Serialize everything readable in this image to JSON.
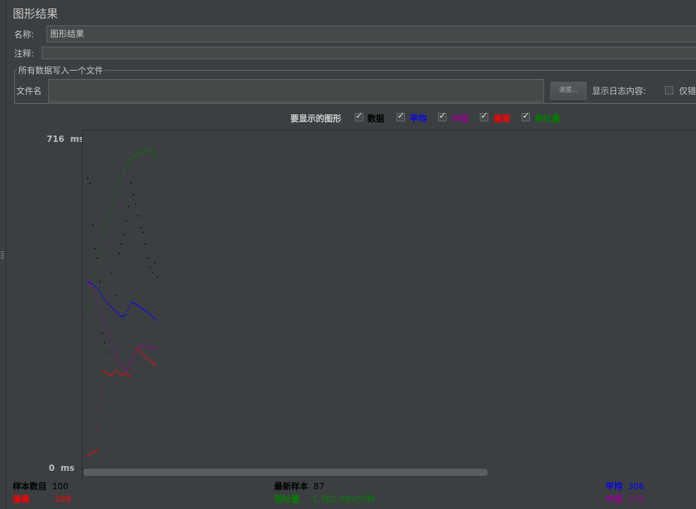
{
  "title": "图形结果",
  "name_label": "名称:",
  "name_value": "图形结果",
  "comment_label": "注释:",
  "comment_value": "",
  "file_group": {
    "legend": "所有数据写入一个文件",
    "file_label": "文件名",
    "file_value": "",
    "browse_label": "浏览...",
    "log_label": "显示日志内容:",
    "errors_only_label": "仅错"
  },
  "graphs": {
    "label": "要显示的图形",
    "items": [
      {
        "label": "数据",
        "checked": true,
        "color": "#000000"
      },
      {
        "label": "平均",
        "checked": true,
        "color": "#0000ff"
      },
      {
        "label": "中值",
        "checked": true,
        "color": "#990099"
      },
      {
        "label": "偏离",
        "checked": true,
        "color": "#ff0000"
      },
      {
        "label": "吞吐量",
        "checked": true,
        "color": "#008000"
      }
    ]
  },
  "y_axis": {
    "max_label": "716",
    "min_label": "0",
    "unit": "ms"
  },
  "stats": {
    "samples_label": "样本数目",
    "samples_value": "100",
    "deviation_label": "偏离",
    "deviation_value": "248",
    "latest_label": "最新样本",
    "latest_value": "87",
    "throughput_label": "吞吐量",
    "throughput_value": "1,362.089/分钟",
    "average_label": "平均",
    "average_value": "306",
    "median_label": "中值",
    "median_value": "175"
  },
  "chart_data": {
    "type": "scatter",
    "ylim": [
      0,
      716
    ],
    "series": [
      {
        "name": "数据",
        "points": [
          [
            1,
            620
          ],
          [
            2,
            610
          ],
          [
            3,
            520
          ],
          [
            4,
            470
          ],
          [
            5,
            450
          ],
          [
            6,
            400
          ],
          [
            7,
            290
          ],
          [
            8,
            270
          ],
          [
            9,
            300
          ],
          [
            10,
            250
          ],
          [
            11,
            420
          ],
          [
            12,
            340
          ],
          [
            13,
            370
          ],
          [
            14,
            460
          ],
          [
            15,
            480
          ],
          [
            16,
            500
          ],
          [
            17,
            530
          ],
          [
            18,
            560
          ],
          [
            19,
            610
          ],
          [
            20,
            585
          ],
          [
            21,
            565
          ],
          [
            22,
            540
          ],
          [
            23,
            515
          ],
          [
            24,
            505
          ],
          [
            25,
            480
          ],
          [
            26,
            450
          ],
          [
            27,
            430
          ],
          [
            28,
            420
          ],
          [
            29,
            440
          ],
          [
            30,
            410
          ]
        ]
      },
      {
        "name": "平均",
        "points": [
          [
            1,
            400
          ],
          [
            3,
            395
          ],
          [
            5,
            385
          ],
          [
            7,
            370
          ],
          [
            9,
            355
          ],
          [
            11,
            345
          ],
          [
            13,
            335
          ],
          [
            15,
            325
          ],
          [
            17,
            330
          ],
          [
            19,
            355
          ],
          [
            21,
            352
          ],
          [
            23,
            345
          ],
          [
            25,
            338
          ],
          [
            27,
            330
          ],
          [
            29,
            320
          ],
          [
            30,
            315
          ]
        ]
      },
      {
        "name": "中值",
        "points": [
          [
            1,
            395
          ],
          [
            3,
            390
          ],
          [
            5,
            370
          ],
          [
            7,
            335
          ],
          [
            9,
            300
          ],
          [
            11,
            270
          ],
          [
            13,
            240
          ],
          [
            15,
            220
          ],
          [
            17,
            210
          ],
          [
            19,
            230
          ],
          [
            21,
            248
          ],
          [
            23,
            262
          ],
          [
            25,
            262
          ],
          [
            27,
            260
          ],
          [
            30,
            258
          ]
        ]
      },
      {
        "name": "偏离",
        "points": [
          [
            1,
            30
          ],
          [
            3,
            35
          ],
          [
            5,
            42
          ],
          [
            7,
            210
          ],
          [
            9,
            205
          ],
          [
            11,
            200
          ],
          [
            13,
            212
          ],
          [
            15,
            200
          ],
          [
            17,
            205
          ],
          [
            19,
            198
          ],
          [
            21,
            260
          ],
          [
            23,
            250
          ],
          [
            25,
            240
          ],
          [
            27,
            230
          ],
          [
            30,
            220
          ]
        ]
      },
      {
        "name": "吞吐量",
        "points": [
          [
            1,
            320
          ],
          [
            3,
            380
          ],
          [
            5,
            430
          ],
          [
            7,
            480
          ],
          [
            9,
            530
          ],
          [
            11,
            560
          ],
          [
            13,
            600
          ],
          [
            15,
            625
          ],
          [
            17,
            645
          ],
          [
            19,
            660
          ],
          [
            21,
            670
          ],
          [
            23,
            675
          ],
          [
            25,
            680
          ],
          [
            27,
            680
          ],
          [
            29,
            670
          ],
          [
            30,
            665
          ]
        ]
      }
    ]
  }
}
